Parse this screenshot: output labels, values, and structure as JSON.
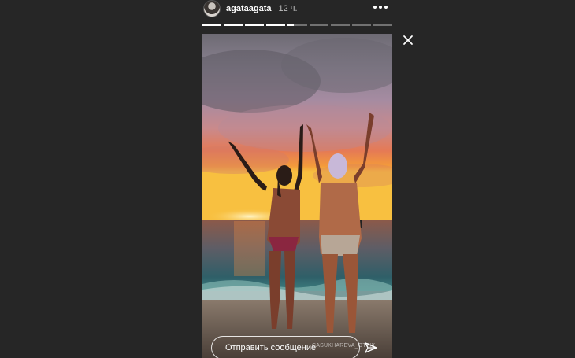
{
  "header": {
    "username": "agataagata",
    "time": "12 ч."
  },
  "progress": {
    "segments": [
      1,
      1,
      1,
      1,
      0.3,
      0,
      0,
      0,
      0
    ]
  },
  "story": {
    "watermark": "CASUKHAREVA_OTTIX"
  },
  "reply": {
    "placeholder": "Отправить сообщение"
  }
}
